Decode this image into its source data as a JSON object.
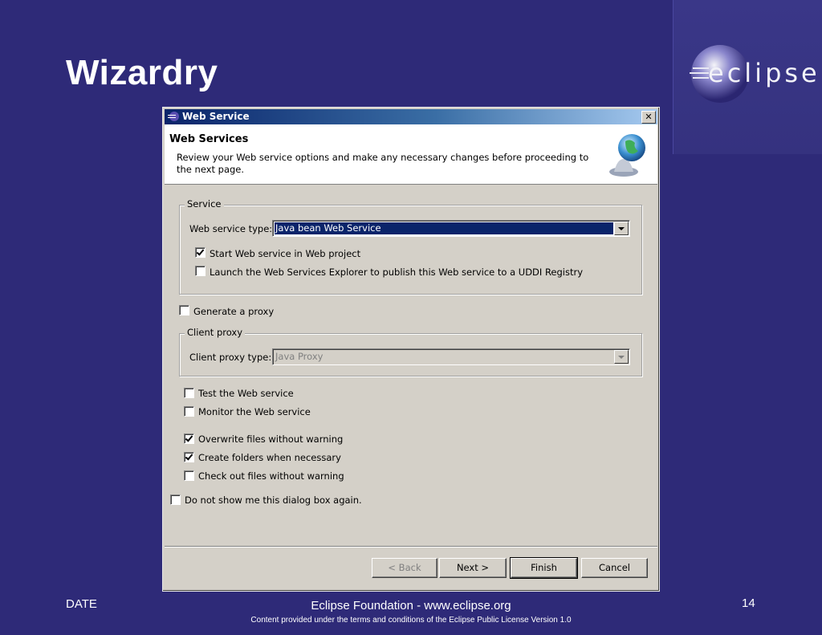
{
  "slide": {
    "title": "Wizardry",
    "logo_text": "eclipse",
    "footer": {
      "date": "DATE",
      "org": "Eclipse Foundation - www.eclipse.org",
      "legal": "Content provided under the terms and conditions of the Eclipse Public License Version 1.0",
      "page": "14"
    }
  },
  "dialog": {
    "title": "Web Service",
    "close_label": "✕",
    "banner": {
      "heading": "Web Services",
      "description": "Review your Web service options and make any necessary changes before proceeding to the next page."
    },
    "service_group": {
      "label": "Service",
      "type_label": "Web service type:",
      "type_value": "Java bean Web Service",
      "start_label": "Start Web service in Web project",
      "start_checked": true,
      "launch_label": "Launch the Web Services Explorer to publish this Web service to a UDDI Registry",
      "launch_checked": false
    },
    "generate_proxy": {
      "label": "Generate a proxy",
      "checked": false
    },
    "client_group": {
      "label": "Client proxy",
      "type_label": "Client proxy type:",
      "type_value": "Java Proxy"
    },
    "options": [
      {
        "label": "Test the Web service",
        "checked": false
      },
      {
        "label": "Monitor the Web service",
        "checked": false
      },
      {
        "label": "Overwrite files without warning",
        "checked": true
      },
      {
        "label": "Create folders when necessary",
        "checked": true
      },
      {
        "label": "Check out files without warning",
        "checked": false
      }
    ],
    "dont_show": {
      "label": "Do not show me this dialog box again.",
      "checked": false
    },
    "buttons": {
      "back": "< Back",
      "next": "Next >",
      "finish": "Finish",
      "cancel": "Cancel"
    }
  },
  "colors": {
    "slide_background": "#2e2a78",
    "dialog_face": "#d4d0c8",
    "titlebar_start": "#0a246a",
    "selection": "#0a246a"
  }
}
